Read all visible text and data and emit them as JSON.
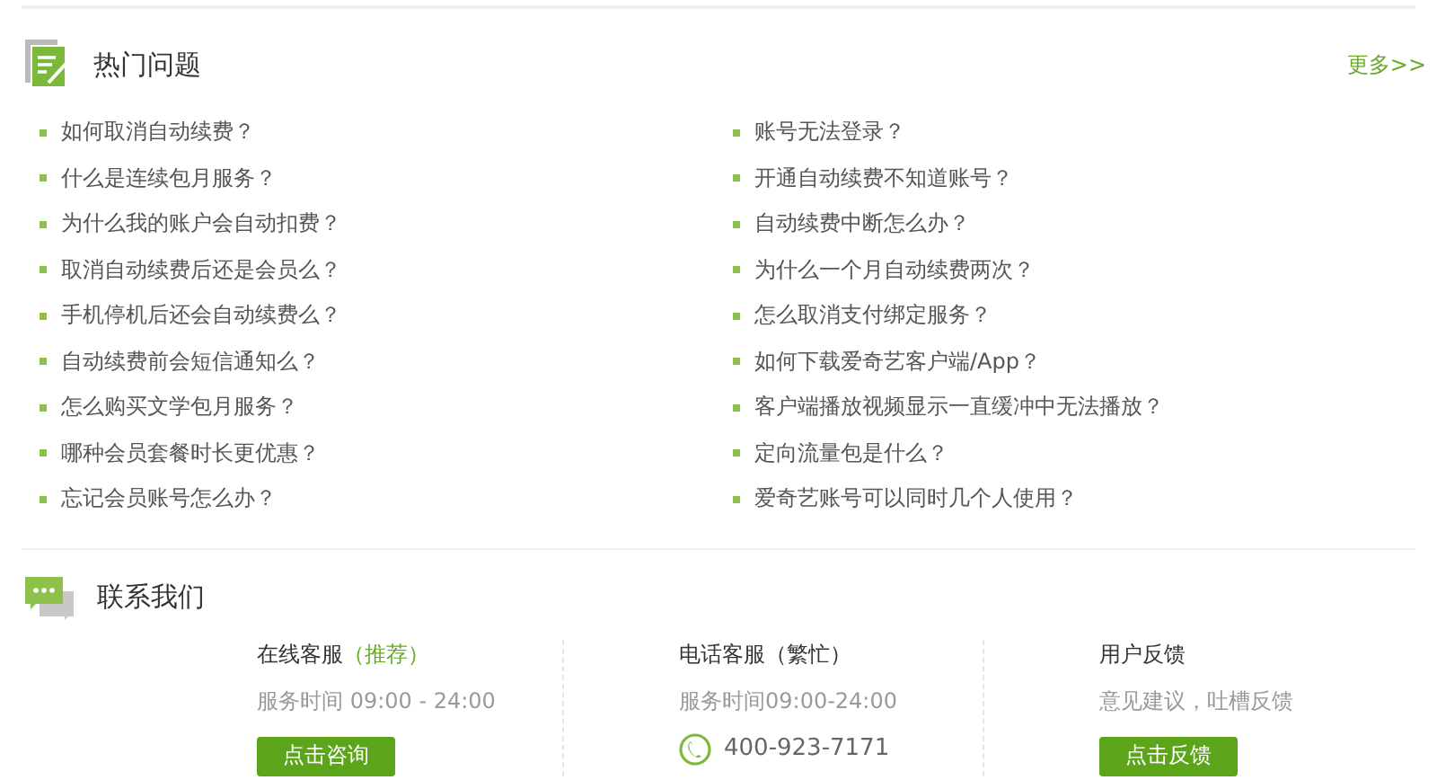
{
  "faq": {
    "title": "热门问题",
    "more_link": "更多>>",
    "left": [
      "如何取消自动续费？",
      "什么是连续包月服务？",
      "为什么我的账户会自动扣费？",
      "取消自动续费后还是会员么？",
      "手机停机后还会自动续费么？",
      "自动续费前会短信通知么？",
      "怎么购买文学包月服务？",
      "哪种会员套餐时长更优惠？",
      "忘记会员账号怎么办？"
    ],
    "right": [
      "账号无法登录？",
      "开通自动续费不知道账号？",
      "自动续费中断怎么办？",
      "为什么一个月自动续费两次？",
      "怎么取消支付绑定服务？",
      "如何下载爱奇艺客户端/App？",
      "客户端播放视频显示一直缓冲中无法播放？",
      "定向流量包是什么？",
      "爱奇艺账号可以同时几个人使用？"
    ]
  },
  "contact": {
    "title": "联系我们",
    "channels": [
      {
        "kind": "button",
        "name": "在线客服",
        "status": "（推荐）",
        "highlight": true,
        "detail": "服务时间 09:00 - 24:00",
        "action": "点击咨询"
      },
      {
        "kind": "phone",
        "name": "电话客服",
        "status": "（繁忙）",
        "highlight": false,
        "detail": "服务时间09:00-24:00",
        "action": "400-923-7171"
      },
      {
        "kind": "button",
        "name": "用户反馈",
        "detail": "意见建议，吐槽反馈",
        "action": "点击反馈"
      }
    ]
  }
}
